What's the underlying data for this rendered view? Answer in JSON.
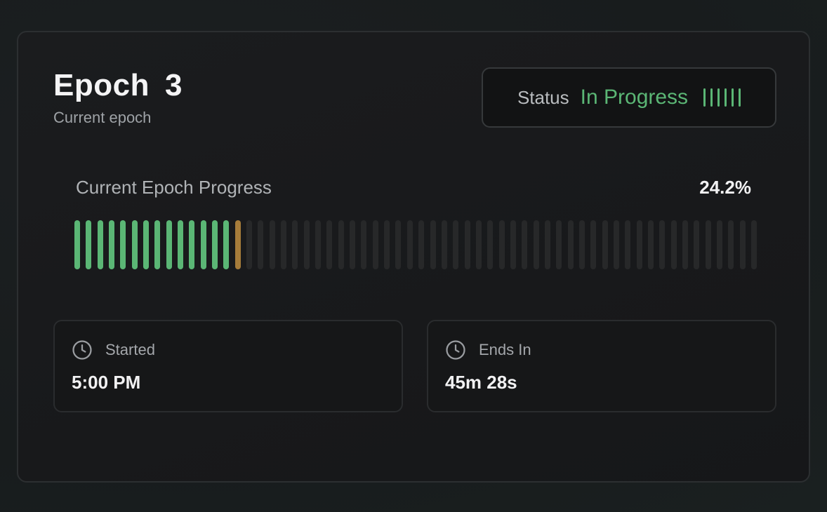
{
  "epoch": {
    "title_word": "Epoch",
    "number": "3",
    "subtitle": "Current epoch"
  },
  "status": {
    "label": "Status",
    "value": "In Progress",
    "indicator_icon": "activity-bars-icon"
  },
  "progress": {
    "label": "Current Epoch Progress",
    "value_text": "24.2%",
    "fraction": 0.242,
    "segments_total": 60,
    "segments_filled": 14
  },
  "started": {
    "label": "Started",
    "value": "5:00 PM",
    "icon": "clock-icon"
  },
  "ends_in": {
    "label": "Ends In",
    "value": "45m 28s",
    "icon": "clock-icon"
  },
  "colors": {
    "accent_green": "#5bb675",
    "current_segment": "#a67c3a",
    "empty_segment": "#272829"
  }
}
